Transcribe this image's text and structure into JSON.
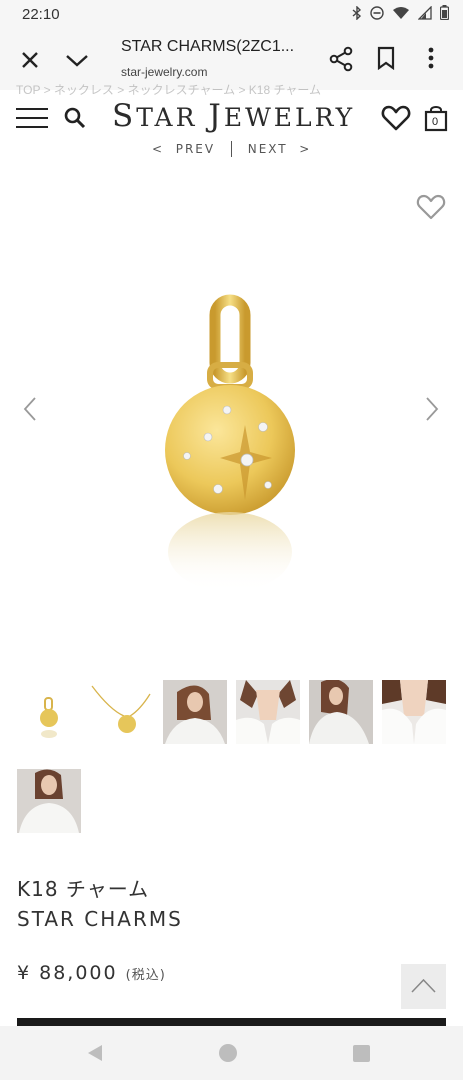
{
  "status_bar": {
    "time": "22:10",
    "icons": [
      "bluetooth-icon",
      "do-not-disturb-icon",
      "wifi-icon",
      "signal-icon",
      "battery-icon"
    ]
  },
  "browser": {
    "title": "STAR CHARMS(2ZC1...",
    "url": "star-jewelry.com",
    "actions": [
      "close-icon",
      "chevron-down-icon",
      "share-icon",
      "bookmark-icon",
      "more-vert-icon"
    ]
  },
  "breadcrumb": "TOP > ネックレス > ネックレスチャーム > K18 チャーム",
  "header": {
    "logo_s": "S",
    "logo_tar": "TAR ",
    "logo_j": "J",
    "logo_ewelry": "EWELRY",
    "cart_count": "0",
    "prev_label": "PREV",
    "next_label": "NEXT",
    "prev_arrow": "<",
    "next_arrow": ">"
  },
  "product": {
    "name_jp": "K18 チャーム",
    "name_en": "STAR CHARMS",
    "price": "¥ 88,000",
    "tax_note": "(税込)"
  },
  "thumbnails": [
    "pendant",
    "necklace",
    "model-1",
    "model-2",
    "model-3",
    "model-4",
    "model-5"
  ],
  "colors": {
    "gold": "#e6c65a",
    "text": "#333333",
    "buy_bar": "#1a1a1a"
  }
}
